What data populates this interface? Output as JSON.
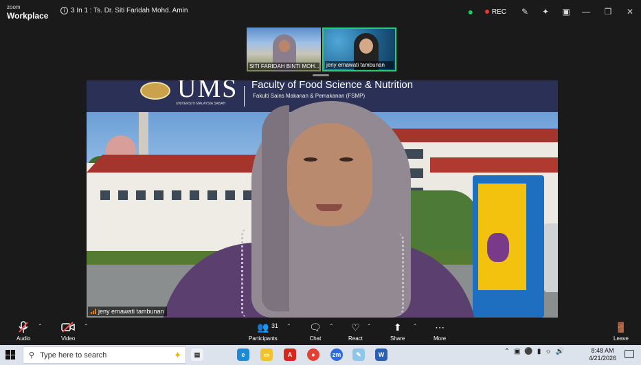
{
  "window": {
    "brand_small": "zoom",
    "brand_large": "Workplace",
    "meeting_title": "3 In 1 : Ts. Dr. Siti Faridah Mohd. Amin",
    "rec_label": "REC",
    "colors": {
      "accent_green": "#23c55e",
      "rec_red": "#e33333",
      "leave_red": "#ff5a5a"
    }
  },
  "thumbnails": [
    {
      "name": "SITI FARIDAH BINTI MOH...",
      "active": false
    },
    {
      "name": "jeny ernawati tambunan",
      "active": true
    }
  ],
  "main_video": {
    "participant_name": "jeny ernawati tambunan",
    "banner": {
      "logo_text": "UMS",
      "logo_sub": "UNIVERSITI MALAYSIA SABAH",
      "faculty": "Faculty of Food Science & Nutrition",
      "faculty_sub": "Fakulti Sains Makanan & Pemakanan (FSMP)"
    }
  },
  "toolbar": {
    "audio": "Audio",
    "video": "Video",
    "participants": "Participants",
    "participant_count": "31",
    "chat": "Chat",
    "react": "React",
    "share": "Share",
    "more": "More",
    "leave": "Leave"
  },
  "taskbar": {
    "search_placeholder": "Type here to search",
    "time": "8:48 AM",
    "date": "4/21/2026"
  }
}
